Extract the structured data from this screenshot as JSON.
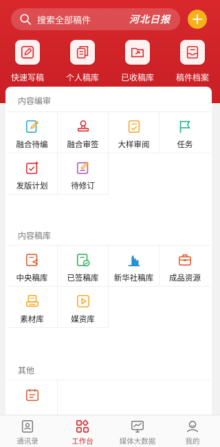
{
  "search": {
    "placeholder": "搜索全部稿件",
    "logo_text": "河北日报"
  },
  "colors": {
    "brand_red": "#d8282c",
    "accent_yellow": "#f5b21a",
    "active_tab": "#d42a2d"
  },
  "quick_actions": [
    {
      "label": "快速写稿",
      "icon": "edit-icon"
    },
    {
      "label": "个人稿库",
      "icon": "document-stack-icon"
    },
    {
      "label": "已收稿库",
      "icon": "folder-send-icon"
    },
    {
      "label": "稿件档案",
      "icon": "archive-tray-icon"
    }
  ],
  "sections": [
    {
      "title": "内容编审",
      "items": [
        {
          "label": "融合待编",
          "icon": "edit-document-icon"
        },
        {
          "label": "融合审签",
          "icon": "stamp-icon"
        },
        {
          "label": "大样审阅",
          "icon": "checklist-icon"
        },
        {
          "label": "任务",
          "icon": "flag-icon"
        },
        {
          "label": "发版计划",
          "icon": "publish-plan-icon"
        },
        {
          "label": "待修订",
          "icon": "revise-icon"
        }
      ]
    },
    {
      "title": "内容稿库",
      "items": [
        {
          "label": "中央稿库",
          "icon": "share-document-icon"
        },
        {
          "label": "已签稿库",
          "icon": "signed-document-icon"
        },
        {
          "label": "新华社稿库",
          "icon": "xinhua-building-icon"
        },
        {
          "label": "成品资源",
          "icon": "toolbox-icon"
        },
        {
          "label": "素材库",
          "icon": "material-print-icon"
        },
        {
          "label": "媒资库",
          "icon": "video-play-icon"
        }
      ]
    },
    {
      "title": "其他",
      "items": [
        {
          "label": "",
          "icon": "calendar-icon"
        }
      ]
    }
  ],
  "tabbar": [
    {
      "label": "通讯录",
      "icon": "contacts-icon",
      "active": false
    },
    {
      "label": "工作台",
      "icon": "workbench-icon",
      "active": true
    },
    {
      "label": "媒体大数据",
      "icon": "monitor-chart-icon",
      "active": false
    },
    {
      "label": "我的",
      "icon": "user-icon",
      "active": false
    }
  ]
}
